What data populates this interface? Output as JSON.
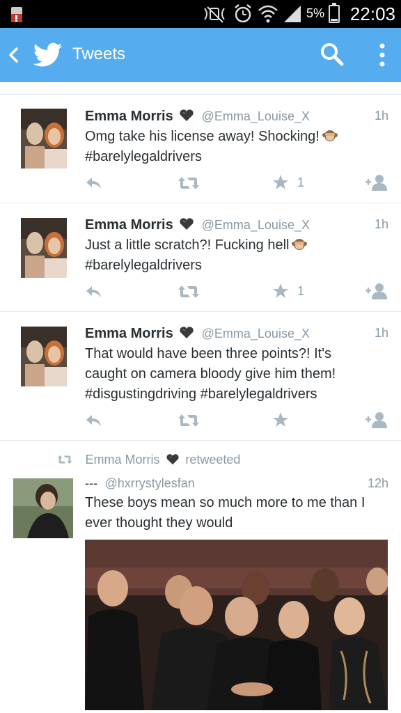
{
  "status_bar": {
    "battery_percent": "5%",
    "time": "22:03"
  },
  "app_bar": {
    "title": "Tweets",
    "icons": [
      "back-icon",
      "twitter-bird-icon",
      "search-icon",
      "overflow-menu-icon"
    ],
    "color": "#55acee"
  },
  "tweets": [
    {
      "name": "Emma Morris",
      "handle": "@Emma_Louise_X",
      "time": "1h",
      "text": "Omg take his license away! Shocking!",
      "hashtags": "#barelylegaldrivers",
      "favorites": "1"
    },
    {
      "name": "Emma Morris",
      "handle": "@Emma_Louise_X",
      "time": "1h",
      "text": "Just a little scratch?! Fucking hell",
      "hashtags": "#barelylegaldrivers",
      "favorites": "1"
    },
    {
      "name": "Emma Morris",
      "handle": "@Emma_Louise_X",
      "time": "1h",
      "text_line1": "That would have been three points?! It's",
      "text_line2": "caught on camera bloody give him them!",
      "hashtags": "#disgustingdriving #barelylegaldrivers",
      "favorites": ""
    },
    {
      "retweeted_by": "Emma Morris",
      "retweeted_label": "retweeted",
      "name": "---",
      "handle": "@hxrrystylesfan",
      "time": "12h",
      "text_line1": "These boys mean so much more to me than I",
      "text_line2": "ever thought they would"
    }
  ]
}
